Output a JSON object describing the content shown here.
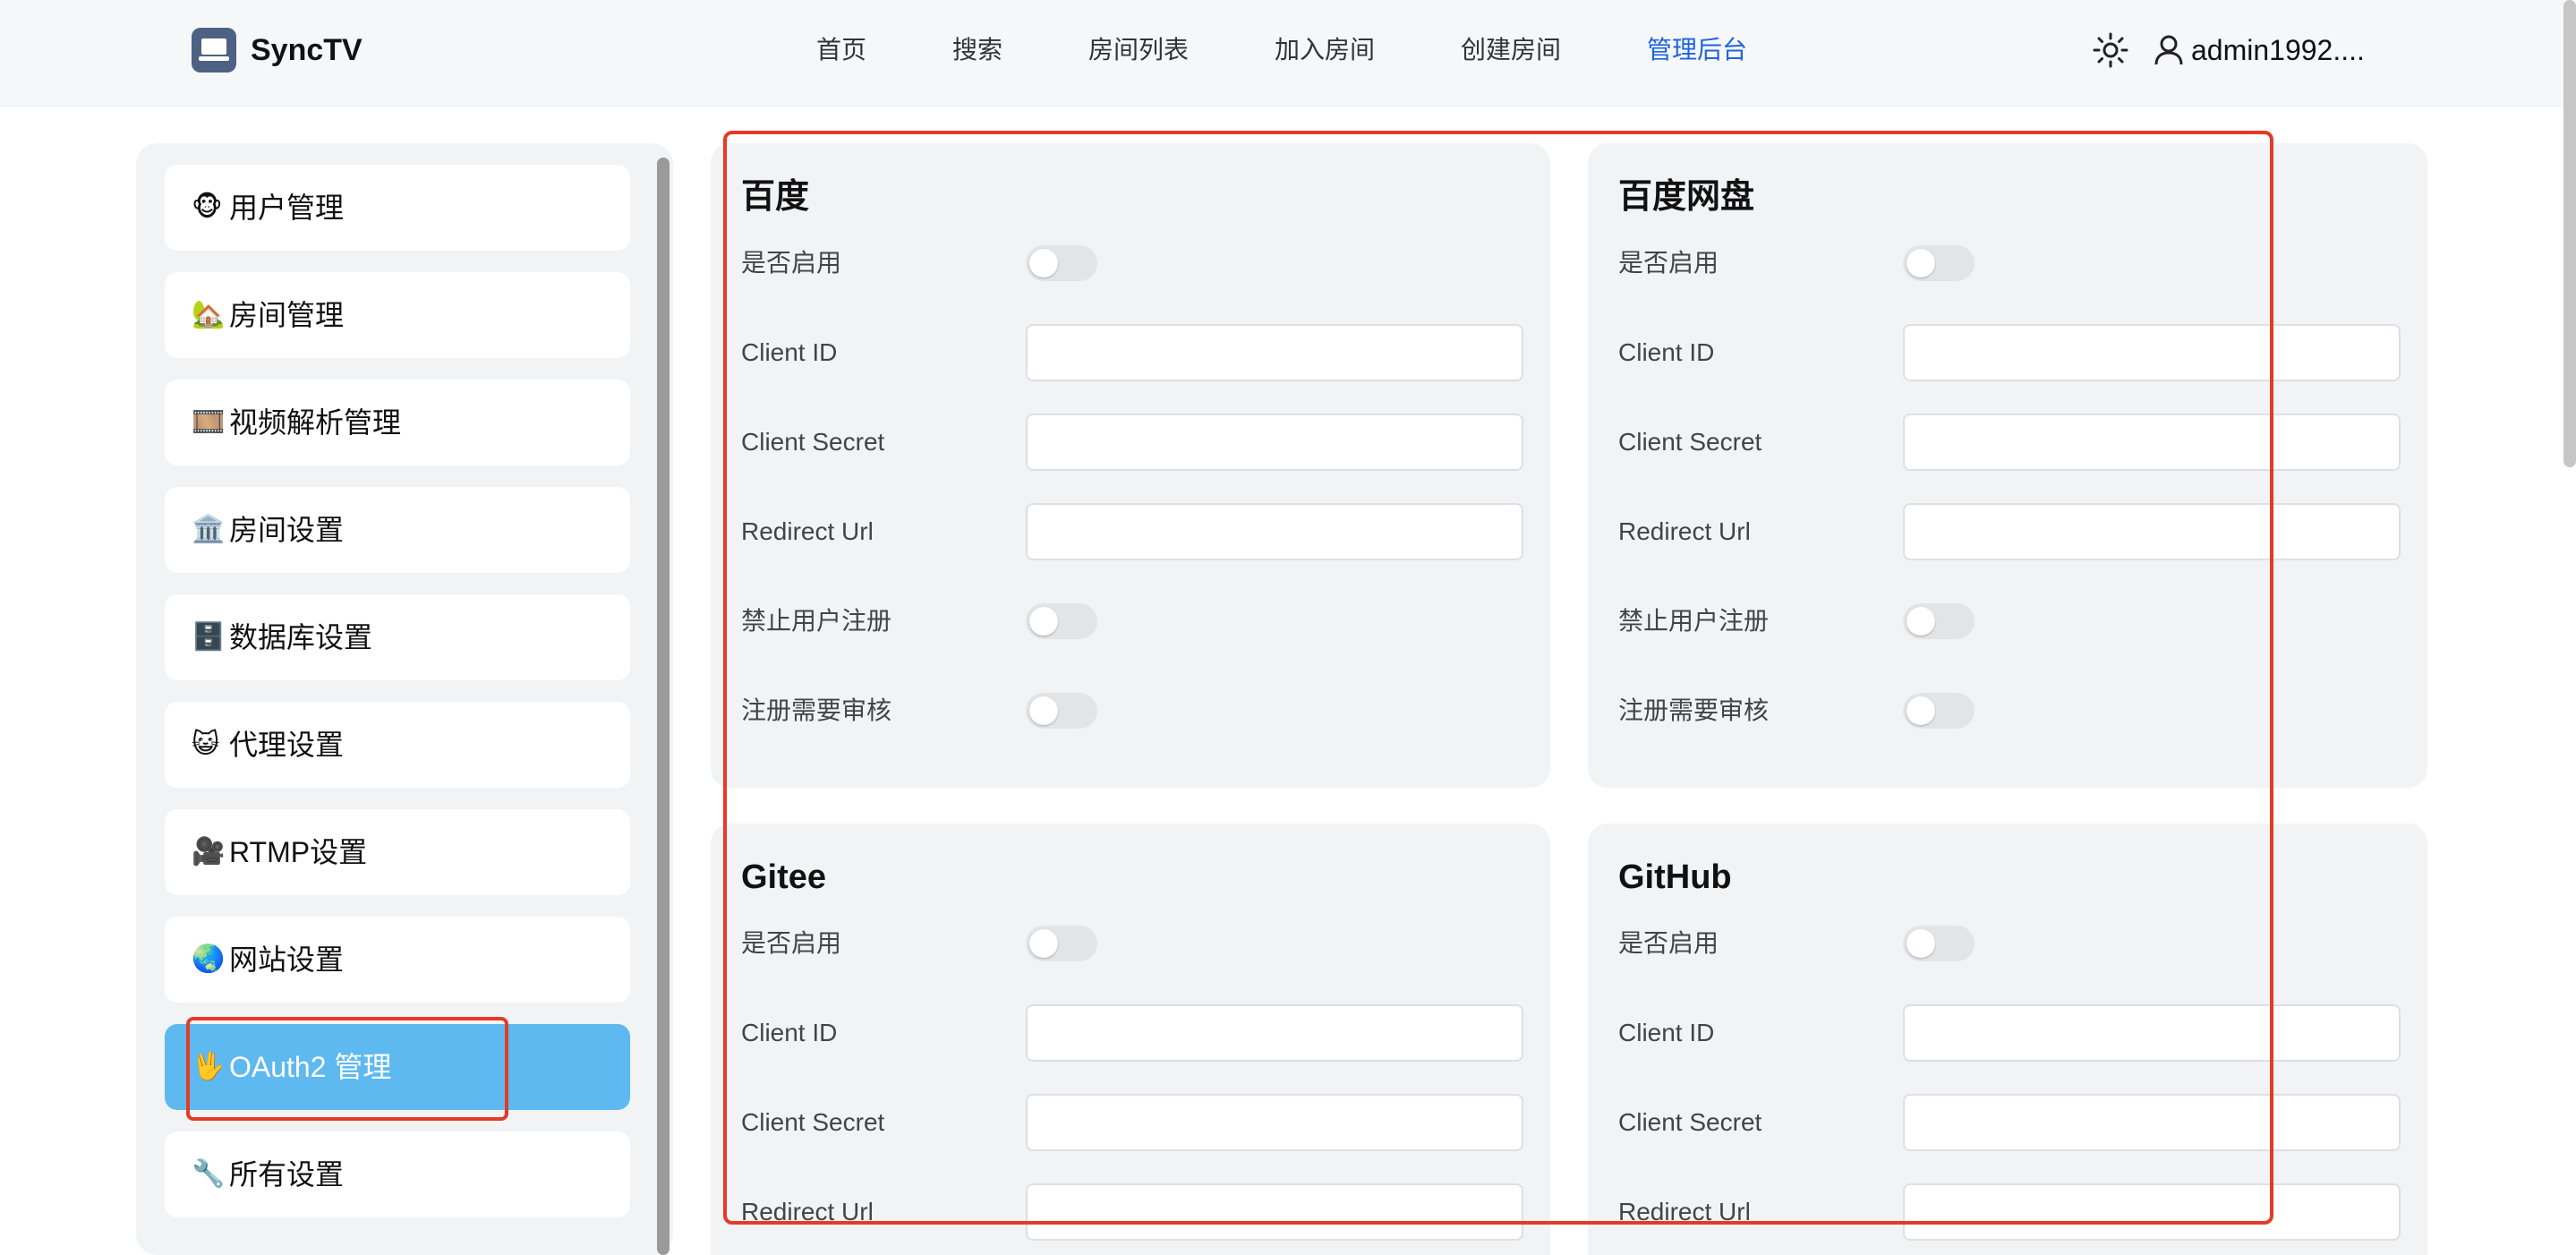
{
  "header": {
    "app_name": "SyncTV",
    "nav": [
      "首页",
      "搜索",
      "房间列表",
      "加入房间",
      "创建房间",
      "管理后台"
    ],
    "active_nav_index": 5,
    "username": "admin1992...."
  },
  "sidebar": {
    "items": [
      {
        "emoji": "🐵",
        "label": "用户管理"
      },
      {
        "emoji": "🏡",
        "label": "房间管理"
      },
      {
        "emoji": "🎞️",
        "label": "视频解析管理"
      },
      {
        "emoji": "🏛️",
        "label": "房间设置"
      },
      {
        "emoji": "🗄️",
        "label": "数据库设置"
      },
      {
        "emoji": "😺",
        "label": "代理设置"
      },
      {
        "emoji": "🎥",
        "label": "RTMP设置"
      },
      {
        "emoji": "🌏",
        "label": "网站设置"
      },
      {
        "emoji": "🖖",
        "label": "OAuth2 管理"
      },
      {
        "emoji": "🔧",
        "label": "所有设置"
      }
    ],
    "active_index": 8
  },
  "field_labels": {
    "enabled": "是否启用",
    "client_id": "Client ID",
    "client_secret": "Client Secret",
    "redirect_url": "Redirect Url",
    "disable_signup": "禁止用户注册",
    "signup_needs_review": "注册需要审核"
  },
  "providers": [
    {
      "name": "百度",
      "enabled": false,
      "client_id": "",
      "client_secret": "",
      "redirect_url": "",
      "disable_signup": false,
      "signup_needs_review": false
    },
    {
      "name": "百度网盘",
      "enabled": false,
      "client_id": "",
      "client_secret": "",
      "redirect_url": "",
      "disable_signup": false,
      "signup_needs_review": false
    },
    {
      "name": "Gitee",
      "enabled": false,
      "client_id": "",
      "client_secret": "",
      "redirect_url": ""
    },
    {
      "name": "GitHub",
      "enabled": false,
      "client_id": "",
      "client_secret": "",
      "redirect_url": ""
    }
  ],
  "colors": {
    "accent": "#1d63e0",
    "sidebar_active": "#5db9f0",
    "highlight_box": "#e53a26"
  }
}
